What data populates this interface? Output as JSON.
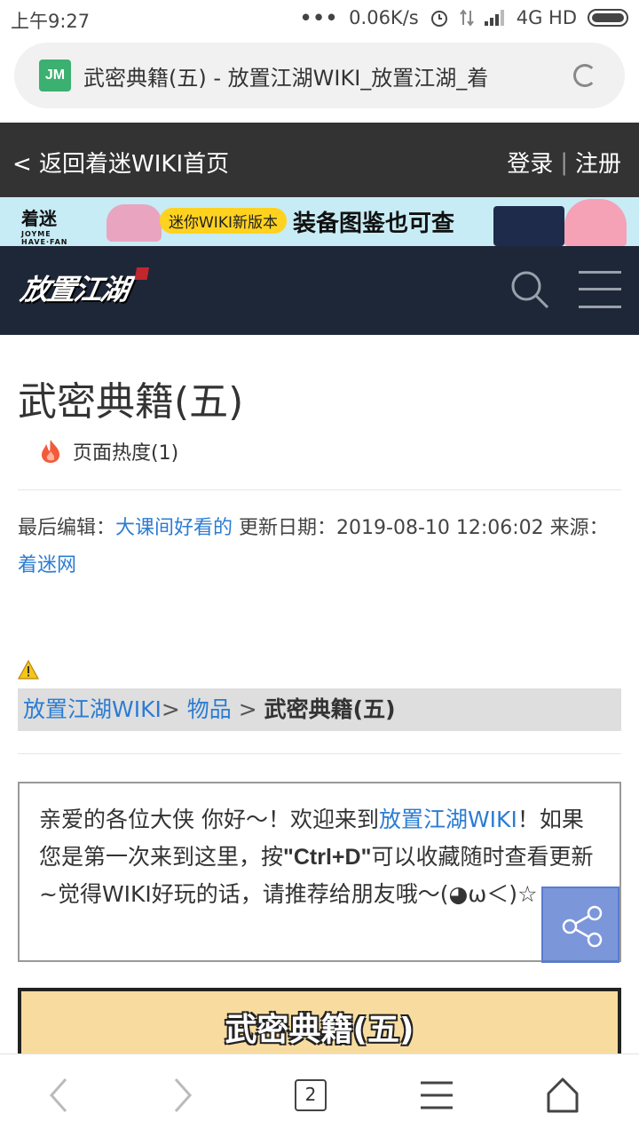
{
  "status_bar": {
    "time": "上午9:27",
    "dots": "•••",
    "speed": "0.06K/s",
    "network": "4G HD"
  },
  "browser": {
    "site_icon_text": "JM",
    "url_title": "武密典籍(五) - 放置江湖WIKI_放置江湖_着",
    "tab_count": "2"
  },
  "top_nav": {
    "back_label": "< 返回着迷WIKI首页",
    "login_label": "登录",
    "separator": "|",
    "register_label": "注册"
  },
  "banner": {
    "logo_text": "着迷",
    "logo_sub": "JOYME HAVE·FAN",
    "pill_text": "迷你WIKI新版本",
    "headline": "装备图鉴也可查"
  },
  "site_header": {
    "logo_text": "放置江湖"
  },
  "page": {
    "title": "武密典籍(五)",
    "heat_label": "页面热度(1)",
    "meta": {
      "last_edit_label": "最后编辑：",
      "editor": "大课间好看的",
      "update_label": " 更新日期：2019-08-10 12:06:02  来源：",
      "source": "着迷网"
    },
    "breadcrumb": {
      "root": "放置江湖WIKI",
      "sep1": "> ",
      "category": "物品",
      "sep2": " > ",
      "current": "武密典籍(五)"
    },
    "welcome": {
      "part1": "亲爱的各位大侠 你好～！欢迎来到",
      "link": "放置江湖WIKI",
      "part2": "！如果您是第一次来到这里，按",
      "hotkey": "\"Ctrl+D\"",
      "part3": "可以收藏随时查看更新~觉得WIKI好玩的话，请推荐给朋友哦～(◕ω＜)☆"
    },
    "item_title": "武密典籍(五)"
  },
  "colors": {
    "link": "#2b7cd3",
    "topnav_bg": "#333333",
    "site_header_bg": "#1e2738",
    "item_title_bg": "#f8dc9f"
  }
}
